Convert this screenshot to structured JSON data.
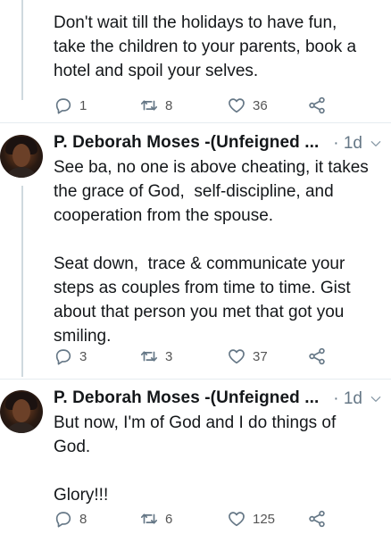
{
  "tweets": [
    {
      "text": "Don't wait till the holidays to have fun,\ntake the children to your parents, book a\nhotel and spoil your selves.",
      "replies": "1",
      "retweets": "8",
      "likes": "36"
    },
    {
      "author": "P. Deborah Moses -(Unfeigned ...",
      "time": "· 1d",
      "text": "See ba, no one is above cheating, it takes\nthe grace of God,  self-discipline, and\ncooperation from the spouse.\n\nSeat down,  trace & communicate your\nsteps as couples from time to time. Gist\nabout that person you met that got you\nsmiling.",
      "replies": "3",
      "retweets": "3",
      "likes": "37"
    },
    {
      "author": "P. Deborah Moses -(Unfeigned ...",
      "time": "· 1d",
      "text": "But now, I'm of God and I do things of\nGod.\n\nGlory!!!",
      "replies": "8",
      "retweets": "6",
      "likes": "125"
    }
  ],
  "icons": {
    "reply": "reply-icon",
    "retweet": "retweet-icon",
    "like": "heart-icon",
    "share": "share-icon",
    "more": "chevron-down-icon"
  },
  "colors": {
    "text": "#14171a",
    "muted": "#657786",
    "thread_line": "#cfd9de",
    "divider": "#e6ecf0"
  }
}
